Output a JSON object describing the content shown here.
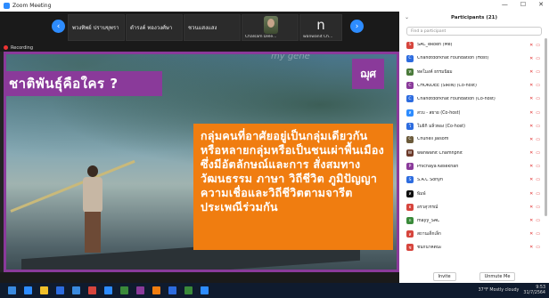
{
  "window": {
    "title": "Zoom Meeting",
    "controls": [
      "—",
      "☐",
      "✕"
    ]
  },
  "video_strip": {
    "thumbnails": [
      {
        "label": "",
        "overlay": "พวงทิพย์ ปราบขุพรา"
      },
      {
        "label": "",
        "overlay": "ดำรงค์ ทองวงศ์ษา"
      },
      {
        "label": "",
        "overlay": "ชวนแสงแสง"
      },
      {
        "label": "Chalsam Dele...",
        "overlay": ""
      },
      {
        "label": "wanwanit Ch...",
        "overlay": "n"
      }
    ],
    "recording": "Recording"
  },
  "slide": {
    "title": "ชาติพันธุ์คือใคร ?",
    "logo": "ฌุศ",
    "signature": "my gene",
    "body": "กลุ่มคนที่อาศัยอยู่เป็นกลุ่มเดียวกันหรือหลายกลุ่มหรือเป็นชนเผ่าพื้นเมือง ซึ่งมีอัตลักษณ์และการ สั่งสมทางวัฒนธรรม ภาษา วิถีชีวิต ภูมิปัญญา ความเชื่อและวิถีชีวิตตามจารีตประเพณีร่วมกัน",
    "colors": {
      "purple": "#8a3a9a",
      "orange": "#f07d10"
    }
  },
  "participants": {
    "header": "Participants (21)",
    "search_placeholder": "Find a participant",
    "list": [
      {
        "initial": "S",
        "name": "SAC_eRoen (Me)",
        "color": "#d6453d"
      },
      {
        "initial": "C",
        "name": "Chanotdorkhat Foundation (Host)",
        "color": "#2d6cdf"
      },
      {
        "initial": "ท",
        "name": "ทดโมงค์ ธรรมนิยม",
        "color": "#4a7a3a"
      },
      {
        "initial": "C",
        "name": "CHOKIDEE (SIRIN) (Co-host)",
        "color": "#8a3a9a"
      },
      {
        "initial": "C",
        "name": "Chanotdorkhat Foundation (Co-host)",
        "color": "#2d6cdf"
      },
      {
        "initial": "ส",
        "name": "สวบ - สยาย (Co-host)",
        "color": "#2d8cff"
      },
      {
        "initial": "โ",
        "name": "โมธิกิ มลิ่วทอง (Co-host)",
        "color": "#2d6cdf"
      },
      {
        "initial": "C",
        "name": "Chunell Jaisom",
        "color": "#6b5a3a"
      },
      {
        "initial": "W",
        "name": "wanwanit Chamnphit",
        "color": "#6b3a2a"
      },
      {
        "initial": "P",
        "name": "Phichaya Kesekhan",
        "color": "#8a3a9a"
      },
      {
        "initial": "S",
        "name": "S.A.C Sonyn",
        "color": "#2d6cdf"
      },
      {
        "initial": "ส",
        "name": "พิมพ์",
        "color": "#111111"
      },
      {
        "initial": "อ",
        "name": "อรวสุวรรณ์",
        "color": "#d6453d"
      },
      {
        "initial": "n",
        "name": "mayy_SAC",
        "color": "#3a8a3a"
      },
      {
        "initial": "ส",
        "name": "สถานเด็กเล็ก",
        "color": "#d6453d"
      },
      {
        "initial": "ช",
        "name": "ชนกนาคตนะ",
        "color": "#d6453d"
      }
    ],
    "footer": {
      "invite": "Invite",
      "unmute": "Unmute Me"
    }
  },
  "taskbar": {
    "weather": "37°F Mostly cloudy",
    "time": "9:53",
    "date": "31/7/2564",
    "icon_colors": [
      "#2d8cff",
      "#f0c02a",
      "#2d6cdf",
      "#3a8adf",
      "#d6453d",
      "#2d8cff",
      "#3a8a3a",
      "#8a3a9a",
      "#f07d10",
      "#2d6cdf",
      "#3a8a3a",
      "#2d8cff"
    ]
  }
}
